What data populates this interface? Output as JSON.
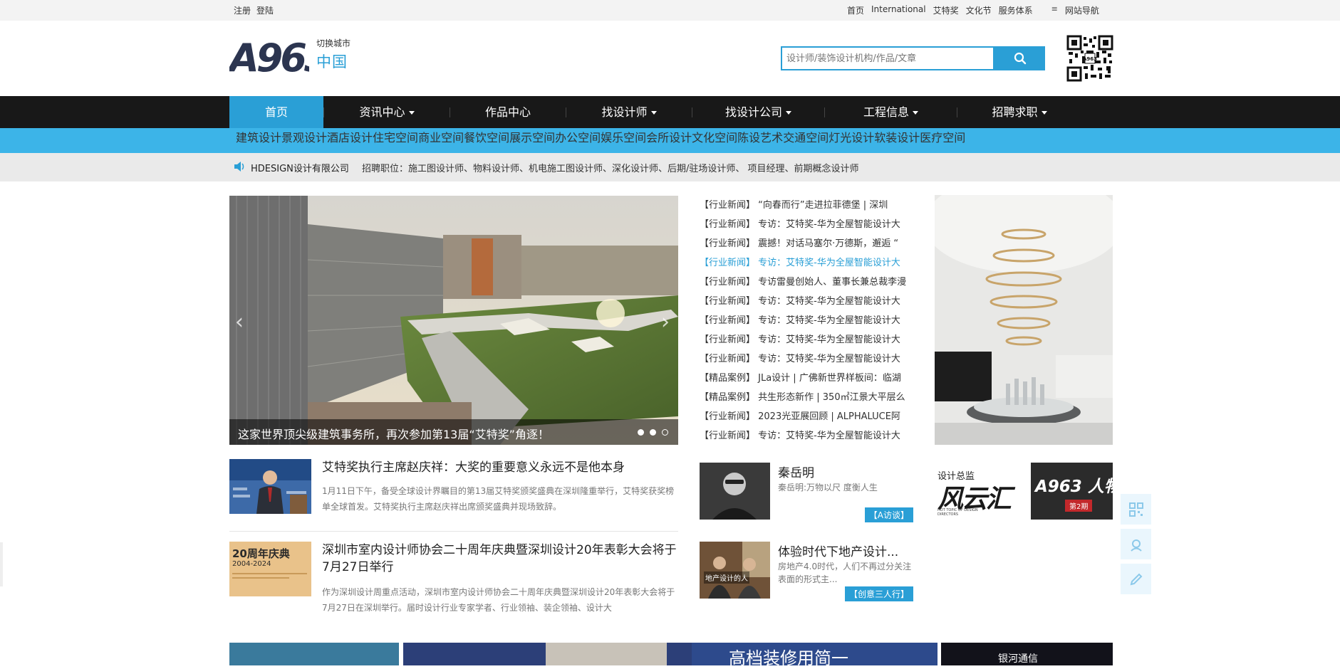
{
  "topbar": {
    "left": [
      "注册",
      "登陆"
    ],
    "right": [
      "首页",
      "International",
      "艾特奖",
      "文化节",
      "服务体系"
    ],
    "site_nav": "网站导航"
  },
  "header": {
    "logo_text": "A963",
    "city_switch": "切换城市",
    "city": "中国",
    "search_placeholder": "设计师/装饰设计机构/作品/文章"
  },
  "mainnav": [
    {
      "label": "首页",
      "dropdown": false,
      "active": true
    },
    {
      "label": "资讯中心",
      "dropdown": true
    },
    {
      "label": "作品中心",
      "dropdown": false
    },
    {
      "label": "找设计师",
      "dropdown": true
    },
    {
      "label": "找设计公司",
      "dropdown": true
    },
    {
      "label": "工程信息",
      "dropdown": true
    },
    {
      "label": "招聘求职",
      "dropdown": true
    }
  ],
  "subnav": [
    "建筑设计",
    "景观设计",
    "酒店设计",
    "住宅空间",
    "商业空间",
    "餐饮空间",
    "展示空间",
    "办公空间",
    "娱乐空间",
    "会所设计",
    "文化空间",
    "陈设艺术",
    "交通空间",
    "灯光设计",
    "软装设计",
    "医疗空间"
  ],
  "notice": {
    "company": "HDESIGN设计有限公司",
    "jobs": "招聘职位：施工图设计师、物料设计师、机电施工图设计师、深化设计师、后期/驻场设计师、 项目经理、前期概念设计师"
  },
  "slider": {
    "caption": "这家世界顶尖级建筑事务所，再次参加第13届“艾特奖”角逐！",
    "active_dot": 2,
    "dots": 3
  },
  "news": [
    "【行业新闻】 “向春而行”走进拉菲德堡 | 深圳",
    "【行业新闻】 专访：艾特奖-华为全屋智能设计大",
    "【行业新闻】 震撼！对话马塞尔·万德斯，邂逅 “",
    "【行业新闻】 专访：艾特奖-华为全屋智能设计大",
    "【行业新闻】 专访雷曼创始人、董事长兼总裁李漫",
    "【行业新闻】 专访：艾特奖-华为全屋智能设计大",
    "【行业新闻】 专访：艾特奖-华为全屋智能设计大",
    "【行业新闻】 专访：艾特奖-华为全屋智能设计大",
    "【行业新闻】 专访：艾特奖-华为全屋智能设计大",
    "【精品案例】 JLa设计 | 广佛新世界样板间：临湖",
    "【精品案例】 共生形态新作 | 350㎡江景大平层么",
    "【行业新闻】 2023光亚展回顾 | ALPHALUCE阿",
    "【行业新闻】 专访：艾特奖-华为全屋智能设计大"
  ],
  "news_highlight": 3,
  "articles": [
    {
      "title": "艾特奖执行主席赵庆祥：大奖的重要意义永远不是他本身",
      "desc": "1月11日下午，备受全球设计界瞩目的第13届艾特奖颁奖盛典在深圳隆重举行，艾特奖获奖榜单全球首发。艾特奖执行主席赵庆祥出席颁奖盛典并现场致辞。"
    },
    {
      "title": "深圳市室内设计师协会二十周年庆典暨深圳设计20年表彰大会将于7月27日举行",
      "desc": "作为深圳设计周重点活动，深圳市室内设计师协会二十周年庆典暨深圳设计20年表彰大会将于7月27日在深圳举行。届时设计行业专家学者、行业领袖、装企领袖、设计大",
      "thumb_text": "20周年庆典",
      "thumb_sub": "2004-2024"
    }
  ],
  "cards": [
    {
      "name": "秦岳明",
      "desc": "秦岳明:万物以尺 度衡人生",
      "tag": "【A访谈】"
    },
    {
      "name": "体验时代下地产设计...",
      "desc": "房地产4.0时代，人们不再过分关注表面的形式主...",
      "tag": "【创意三人行】",
      "img_text": "地产设计的人"
    }
  ],
  "promos": {
    "promo1_top": "设计总监",
    "promo1_main": "风云汇",
    "promo1_en": "HOT TOPIC OF DESIGN DIRECTORS",
    "promo2_main": "A963 人物",
    "promo2_sub": "第2期"
  },
  "ads": [
    "高档装修用简一",
    "银河通信"
  ],
  "colors": {
    "accent": "#2a9fd6",
    "subnav": "#3cb4e8",
    "mainnav": "#181818"
  }
}
